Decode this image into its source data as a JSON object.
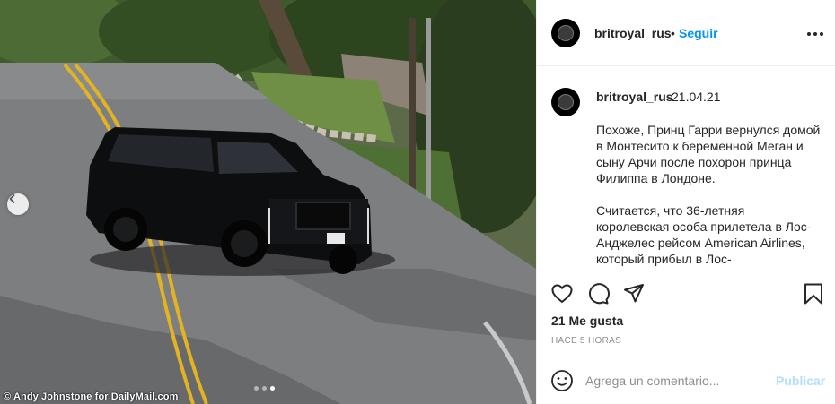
{
  "photo": {
    "credit": "© Andy Johnstone for DailyMail.com",
    "carousel_dots": 3,
    "active_dot": 3
  },
  "post_header": {
    "username": "britroyal_rus",
    "separator": "•",
    "follow_label": "Seguir"
  },
  "caption": {
    "username": "britroyal_rus",
    "date": "21.04.21",
    "paragraphs": [
      "Похоже, Принц Гарри вернулся домой в Монтесито к беременной Меган и сыну Арчи после похорон принца Филиппа в Лондоне.",
      "Считается, что 36-летняя королевская особа прилетела в Лос-Анджелес рейсом American Airlines, который прибыл в Лос-"
    ]
  },
  "actions": {
    "icons": [
      "heart-icon",
      "comment-icon",
      "share-icon",
      "bookmark-icon"
    ]
  },
  "stats": {
    "likes": "21 Me gusta",
    "time_ago": "HACE 5 HORAS"
  },
  "comment_box": {
    "placeholder": "Agrega un comentario...",
    "publish_label": "Publicar"
  },
  "colors": {
    "link_blue": "#0095f6",
    "publish_disabled": "#b2dffc",
    "text": "#262626",
    "muted": "#8e8e8e",
    "border": "#efefef"
  }
}
